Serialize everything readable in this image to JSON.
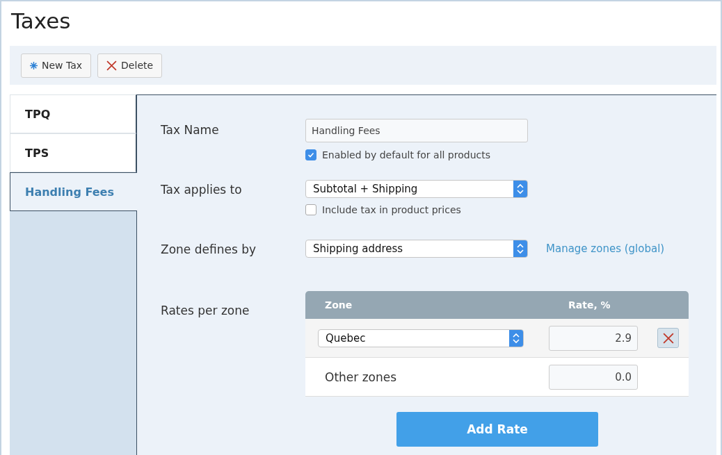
{
  "page": {
    "title": "Taxes"
  },
  "toolbar": [
    {
      "kind": "new",
      "label": "New Tax"
    },
    {
      "kind": "delete",
      "label": "Delete"
    }
  ],
  "tax_list": [
    {
      "label": "TPQ",
      "selected": false
    },
    {
      "label": "TPS",
      "selected": false
    },
    {
      "label": "Handling Fees",
      "selected": true
    }
  ],
  "form": {
    "name": {
      "label": "Tax Name",
      "value": "Handling Fees"
    },
    "enabled": {
      "label": "Enabled by default for all products",
      "checked": true
    },
    "applies": {
      "label": "Tax applies to",
      "value": "Subtotal + Shipping"
    },
    "include": {
      "label": "Include tax in product prices",
      "checked": false
    },
    "zone": {
      "label": "Zone defines by",
      "value": "Shipping address",
      "link": "Manage zones (global)"
    },
    "rates": {
      "label": "Rates per zone",
      "columns": [
        "Zone",
        "Rate, %"
      ],
      "rows": [
        {
          "kind": "select",
          "zone": "Quebec",
          "rate": "2.9",
          "removable": true
        },
        {
          "kind": "text",
          "zone": "Other zones",
          "rate": "0.0",
          "removable": false
        }
      ],
      "add_button": "Add Rate"
    }
  }
}
